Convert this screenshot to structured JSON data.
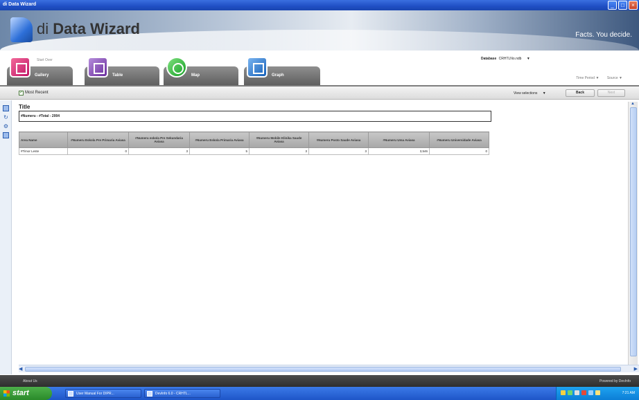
{
  "window": {
    "title": "di Data Wizard"
  },
  "header": {
    "logo_prefix": "di",
    "logo_name": "Data Wizard",
    "tagline": "Facts. You decide."
  },
  "nav": {
    "start_over": "Start Over",
    "tabs": [
      {
        "label": "Gallery",
        "icon": "gallery-icon",
        "color": "#c21567"
      },
      {
        "label": "Table",
        "icon": "table-icon",
        "color": "#6b2e9e"
      },
      {
        "label": "Map",
        "icon": "map-icon",
        "color": "#16a025"
      },
      {
        "label": "Graph",
        "icon": "graph-icon",
        "color": "#1560b8"
      }
    ],
    "database_label": "Database",
    "database_value": "CRHTLNo.ndb",
    "time_period": "Time Period",
    "source": "Source"
  },
  "toolbar": {
    "most_recent_label": "Most Recent",
    "most_recent_checked": true,
    "view_selections": "View selections",
    "back_label": "Back",
    "next_label": "Next"
  },
  "content": {
    "title": "Title",
    "subtitle": "#Numeru - #Total - 2004",
    "table": {
      "headers": [
        "Area Name",
        "#Numeru Eskola Pre Primaria Aviasa",
        "#Numeru eskola Pre Sekundaria Aviasa",
        "#Numeru Eskola Primaria Aviasa",
        "#Numeru Mobile Klinika Saude Aviasa",
        "#Numeru Posto Saude Aviasa",
        "#Numeru Uma Aviasa",
        "#Numeru Universidade Aviasa"
      ],
      "rows": [
        [
          "#Timor Leste",
          "0",
          "3",
          "5",
          "3",
          "3",
          "3,546",
          "0"
        ]
      ]
    }
  },
  "footer": {
    "about": "About Us",
    "powered": "Powered by DevInfo"
  },
  "taskbar": {
    "start": "start",
    "tasks": [
      "User Manual For DIPR...",
      "DevInfo 6.0 - CRHTL..."
    ],
    "clock": "7:21 AM"
  }
}
